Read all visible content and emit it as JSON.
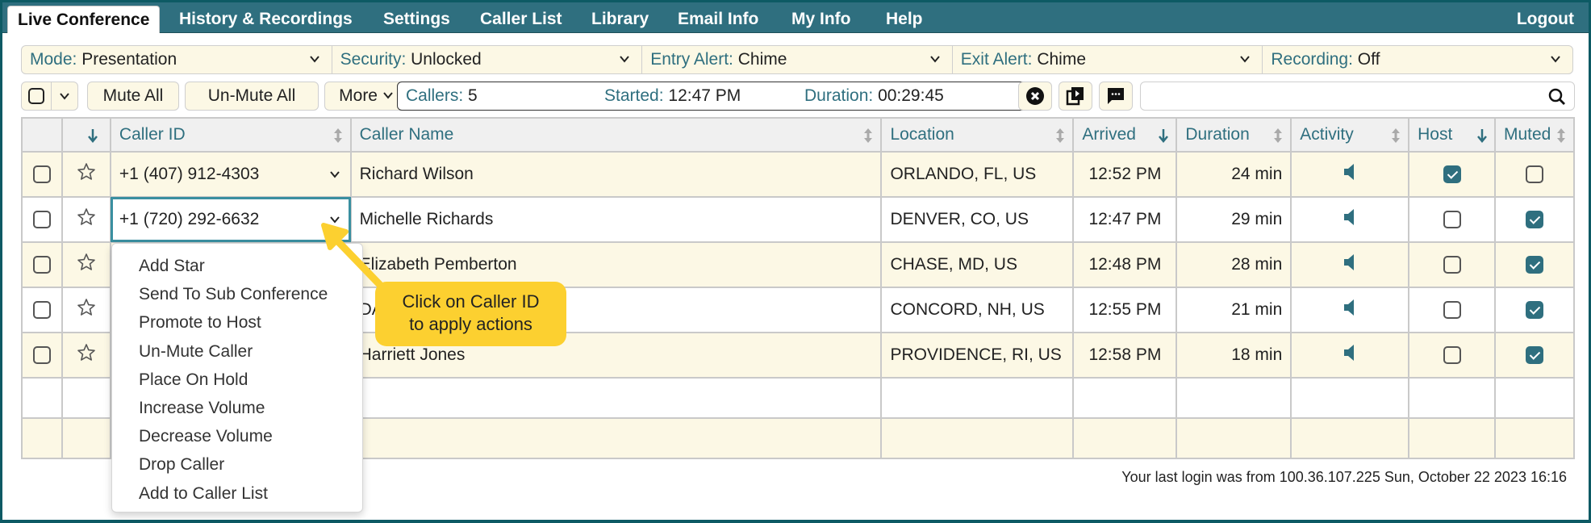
{
  "nav": {
    "tabs": [
      {
        "label": "Live Conference",
        "active": true
      },
      {
        "label": "History & Recordings",
        "active": false
      },
      {
        "label": "Settings",
        "active": false
      },
      {
        "label": "Caller List",
        "active": false
      },
      {
        "label": "Library",
        "active": false
      },
      {
        "label": "Email Info",
        "active": false
      },
      {
        "label": "My Info",
        "active": false
      },
      {
        "label": "Help",
        "active": false
      }
    ],
    "logout": "Logout"
  },
  "settings": [
    {
      "label": "Mode:",
      "value": "Presentation"
    },
    {
      "label": "Security:",
      "value": "Unlocked"
    },
    {
      "label": "Entry Alert:",
      "value": "Chime"
    },
    {
      "label": "Exit Alert:",
      "value": "Chime"
    },
    {
      "label": "Recording:",
      "value": "Off"
    }
  ],
  "toolbar": {
    "mute_all": "Mute All",
    "unmute_all": "Un-Mute All",
    "more": "More",
    "callers_label": "Callers:",
    "callers_value": "5",
    "started_label": "Started:",
    "started_value": "12:47 PM",
    "duration_label": "Duration:",
    "duration_value": "00:29:45",
    "search_placeholder": ""
  },
  "table": {
    "headers": {
      "caller_id": "Caller ID",
      "caller_name": "Caller Name",
      "location": "Location",
      "arrived": "Arrived",
      "duration": "Duration",
      "activity": "Activity",
      "host": "Host",
      "muted": "Muted"
    },
    "rows": [
      {
        "caller_id": "+1 (407) 912-4303",
        "name": "Richard Wilson",
        "location": "ORLANDO, FL, US",
        "arrived": "12:52 PM",
        "duration": "24 min",
        "host": true,
        "muted": false
      },
      {
        "caller_id": "+1 (720) 292-6632",
        "name": "Michelle Richards",
        "location": "DENVER, CO, US",
        "arrived": "12:47 PM",
        "duration": "29 min",
        "host": false,
        "muted": true
      },
      {
        "caller_id": "",
        "name": "Elizabeth Pemberton",
        "location": "CHASE, MD, US",
        "arrived": "12:48 PM",
        "duration": "28 min",
        "host": false,
        "muted": true
      },
      {
        "caller_id": "",
        "name": "DA",
        "location": "CONCORD, NH, US",
        "arrived": "12:55 PM",
        "duration": "21 min",
        "host": false,
        "muted": true
      },
      {
        "caller_id": "",
        "name": "Harriett Jones",
        "location": "PROVIDENCE, RI, US",
        "arrived": "12:58 PM",
        "duration": "18 min",
        "host": false,
        "muted": true
      }
    ]
  },
  "menu": {
    "items": [
      "Add Star",
      "Send To Sub Conference",
      "Promote to Host",
      "Un-Mute Caller",
      "Place On Hold",
      "Increase Volume",
      "Decrease Volume",
      "Drop Caller",
      "Add to Caller List"
    ]
  },
  "callout": {
    "line1": "Click on Caller ID",
    "line2": "to apply actions"
  },
  "footer": {
    "last_login": "Your last login was from 100.36.107.225 Sun, October 22 2023 16:16"
  },
  "colors": {
    "accent": "#2f6f7f",
    "row_highlight": "#fcf8e5",
    "callout": "#fcd030",
    "frame": "#0d5a64"
  }
}
